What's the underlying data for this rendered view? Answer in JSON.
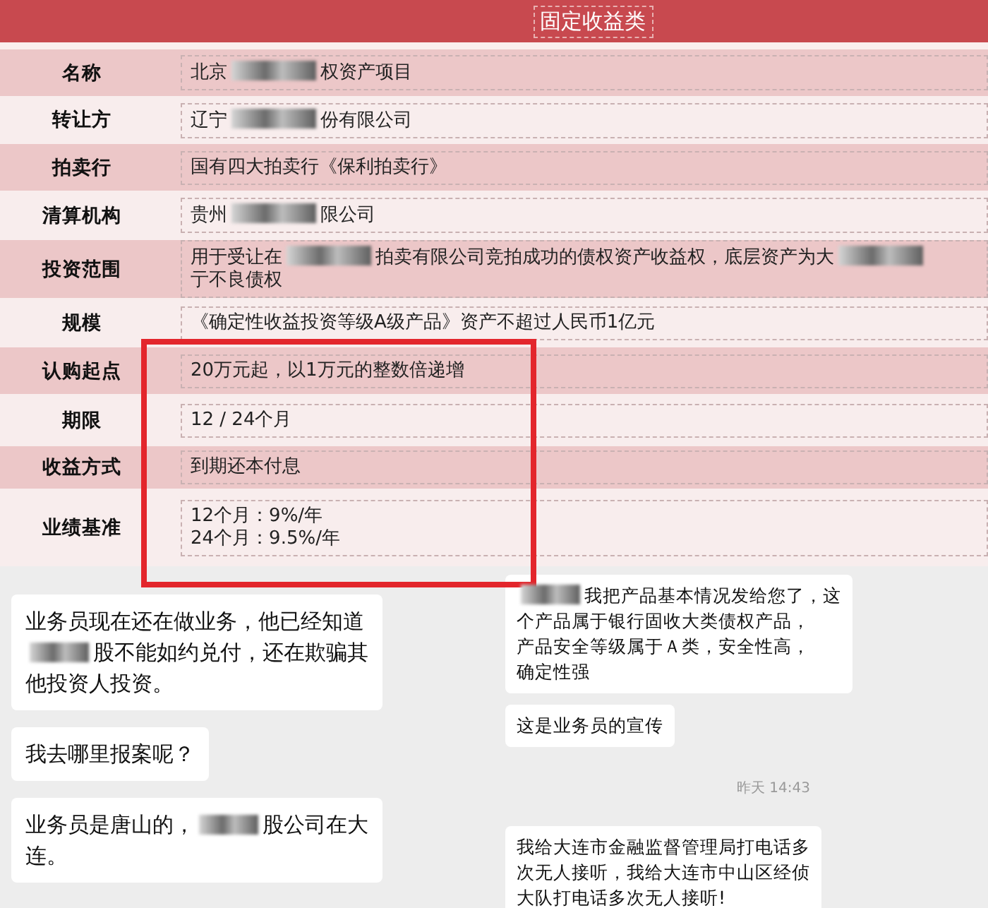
{
  "header": {
    "title": "固定收益类"
  },
  "rows": [
    {
      "label": "名称",
      "value": [
        {
          "kind": "text",
          "text": "北京"
        },
        {
          "kind": "redacted"
        },
        {
          "kind": "text",
          "text": "权资产项目"
        }
      ]
    },
    {
      "label": "转让方",
      "value": [
        {
          "kind": "text",
          "text": "辽宁"
        },
        {
          "kind": "redacted"
        },
        {
          "kind": "text",
          "text": "份有限公司"
        }
      ]
    },
    {
      "label": "拍卖行",
      "value": [
        {
          "kind": "text",
          "text": "国有四大拍卖行《保利拍卖行》"
        }
      ]
    },
    {
      "label": "清算机构",
      "value": [
        {
          "kind": "text",
          "text": "贵州"
        },
        {
          "kind": "redacted"
        },
        {
          "kind": "text",
          "text": "限公司"
        }
      ]
    },
    {
      "label": "投资范围",
      "value": [
        {
          "kind": "text",
          "text": "用于受让在"
        },
        {
          "kind": "redacted"
        },
        {
          "kind": "text",
          "text": "拍卖有限公司竞拍成功的债权资产收益权，底层资产为大"
        },
        {
          "kind": "redacted"
        },
        {
          "kind": "text",
          "text": "亍不良债权"
        }
      ]
    },
    {
      "label": "规模",
      "value": [
        {
          "kind": "text",
          "text": "《确定性收益投资等级A级产品》资产不超过人民币1亿元"
        }
      ]
    },
    {
      "label": "认购起点",
      "value": [
        {
          "kind": "text",
          "text": "20万元起，以1万元的整数倍递增"
        }
      ]
    },
    {
      "label": "期限",
      "value": [
        {
          "kind": "text",
          "text": "12 / 24个月"
        }
      ]
    },
    {
      "label": "收益方式",
      "value": [
        {
          "kind": "text",
          "text": "到期还本付息"
        }
      ]
    },
    {
      "label": "业绩基准",
      "value": [
        {
          "kind": "text",
          "text": "12个月：9%/年"
        },
        {
          "kind": "break"
        },
        {
          "kind": "text",
          "text": "24个月：9.5%/年"
        }
      ]
    }
  ],
  "chat": {
    "left": [
      {
        "kind": "bubble",
        "parts": [
          {
            "kind": "text",
            "text": "业务员现在还在做业务，他已经知道"
          },
          {
            "kind": "break"
          },
          {
            "kind": "redacted"
          },
          {
            "kind": "text",
            "text": "股不能如约兑付，还在欺骗其"
          },
          {
            "kind": "break"
          },
          {
            "kind": "text",
            "text": "他投资人投资。"
          }
        ]
      },
      {
        "kind": "bubble",
        "parts": [
          {
            "kind": "text",
            "text": "我去哪里报案呢？"
          }
        ]
      },
      {
        "kind": "bubble",
        "parts": [
          {
            "kind": "text",
            "text": "业务员是唐山的，"
          },
          {
            "kind": "redacted"
          },
          {
            "kind": "text",
            "text": "股公司在大"
          },
          {
            "kind": "break"
          },
          {
            "kind": "text",
            "text": "连。"
          }
        ]
      }
    ],
    "right": [
      {
        "kind": "bubble",
        "parts": [
          {
            "kind": "redacted"
          },
          {
            "kind": "text",
            "text": "我把产品基本情况发给您了，这"
          },
          {
            "kind": "break"
          },
          {
            "kind": "text",
            "text": "个产品属于银行固收大类债权产品，"
          },
          {
            "kind": "break"
          },
          {
            "kind": "text",
            "text": "产品安全等级属于Ａ类，安全性高，"
          },
          {
            "kind": "break"
          },
          {
            "kind": "text",
            "text": "确定性强"
          }
        ]
      },
      {
        "kind": "bubble",
        "parts": [
          {
            "kind": "text",
            "text": "这是业务员的宣传"
          }
        ]
      },
      {
        "kind": "time",
        "text": "昨天 14:43"
      },
      {
        "kind": "bubble",
        "parts": [
          {
            "kind": "text",
            "text": "我给大连市金融监督管理局打电话多"
          },
          {
            "kind": "break"
          },
          {
            "kind": "text",
            "text": "次无人接听，我给大连市中山区经侦"
          },
          {
            "kind": "break"
          },
          {
            "kind": "text",
            "text": "大队打电话多次无人接听!"
          }
        ]
      }
    ]
  }
}
